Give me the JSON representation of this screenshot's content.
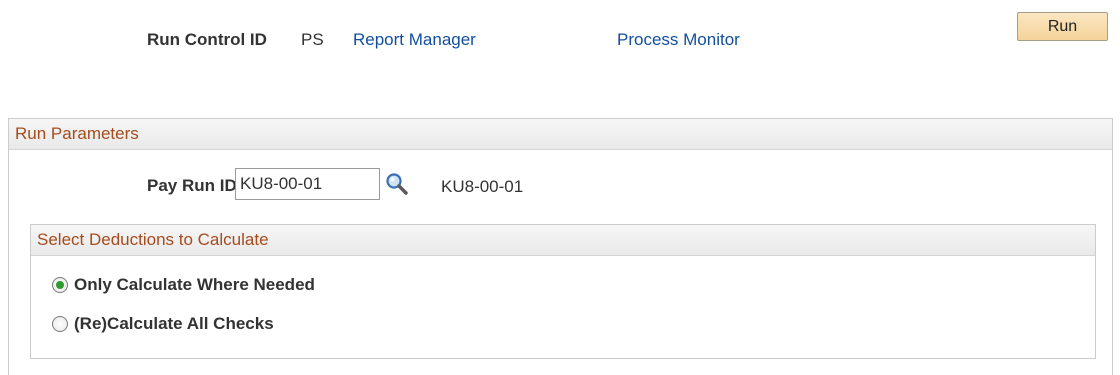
{
  "header": {
    "run_control_label": "Run Control ID",
    "run_control_value": "PS",
    "report_manager_link": "Report Manager",
    "process_monitor_link": "Process Monitor",
    "run_button": "Run"
  },
  "run_parameters": {
    "title": "Run Parameters",
    "pay_run_id_label": "Pay Run ID",
    "pay_run_id_value": "KU8-00-01",
    "pay_run_id_description": "KU8-00-01",
    "lookup_icon": "magnifier-icon"
  },
  "deductions": {
    "title": "Select Deductions to Calculate",
    "options": [
      {
        "label": "Only Calculate Where Needed",
        "selected": true
      },
      {
        "label": "(Re)Calculate All Checks",
        "selected": false
      }
    ]
  },
  "colors": {
    "link": "#114f9c",
    "group_title": "#a44c1d",
    "run_button": "#f4d39a",
    "radio_selected": "#2f9a2f"
  }
}
